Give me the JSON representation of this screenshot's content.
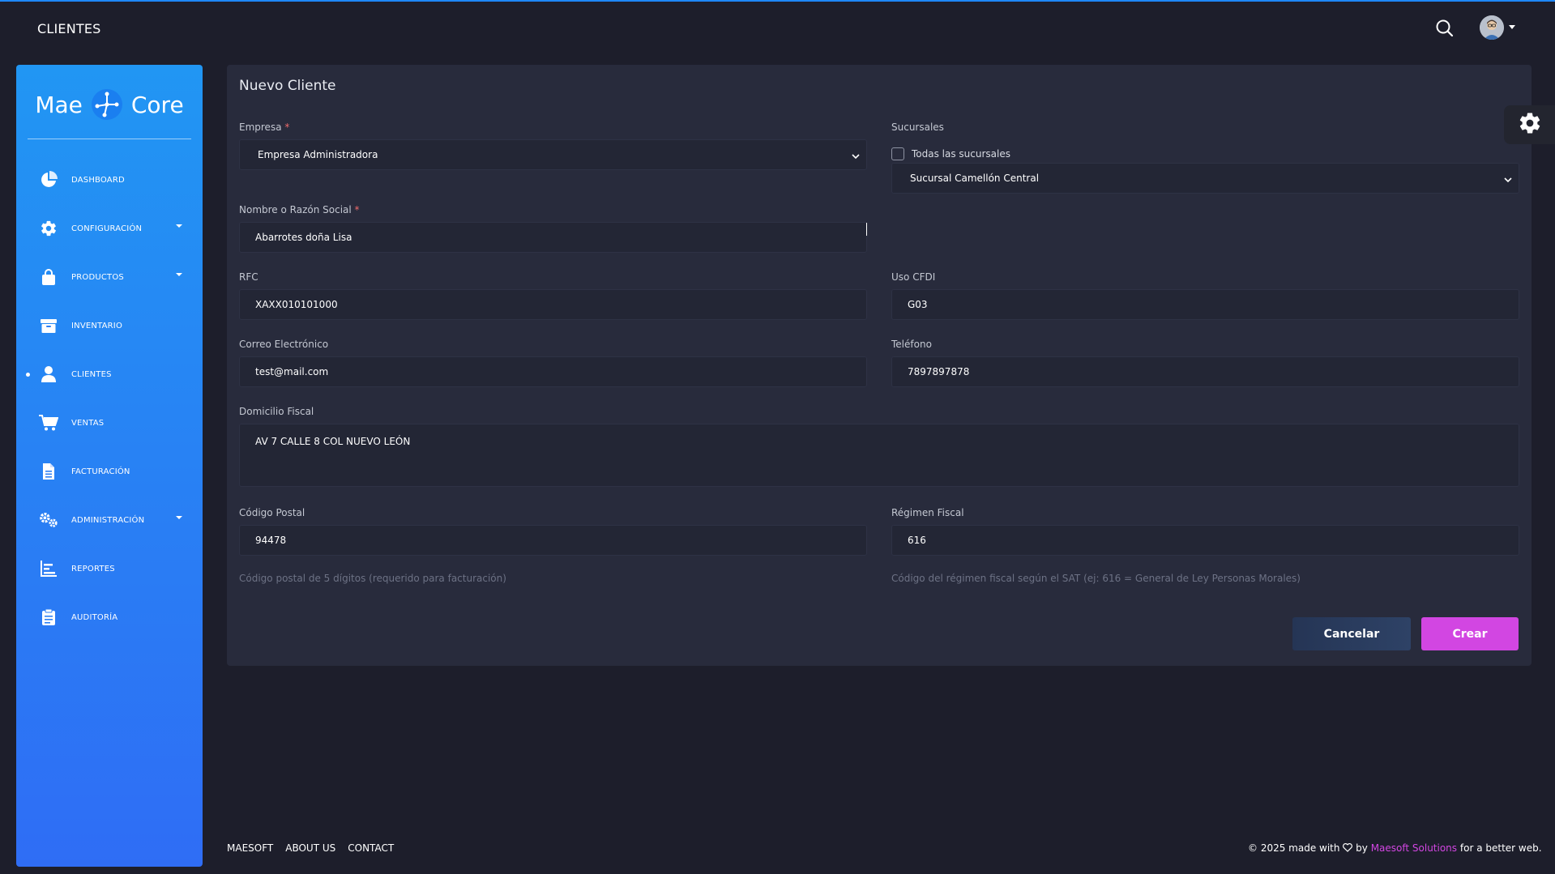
{
  "header": {
    "title": "CLIENTES"
  },
  "brand": {
    "left": "Mae",
    "right": "Core"
  },
  "sidebar": {
    "items": [
      {
        "label": "DASHBOARD",
        "icon": "pie-chart-icon"
      },
      {
        "label": "CONFIGURACIÓN",
        "icon": "gear-icon"
      },
      {
        "label": "PRODUCTOS",
        "icon": "shopping-bag-icon"
      },
      {
        "label": "INVENTARIO",
        "icon": "archive-box-icon"
      },
      {
        "label": "CLIENTES",
        "icon": "user-icon"
      },
      {
        "label": "VENTAS",
        "icon": "cart-icon"
      },
      {
        "label": "FACTURACIÓN",
        "icon": "file-icon"
      },
      {
        "label": "ADMINISTRACIÓN",
        "icon": "gears-icon"
      },
      {
        "label": "REPORTES",
        "icon": "bar-chart-icon"
      },
      {
        "label": "AUDITORÍA",
        "icon": "clipboard-icon"
      }
    ]
  },
  "form": {
    "title": "Nuevo Cliente",
    "empresa": {
      "label": "Empresa",
      "value": "Empresa Administradora"
    },
    "sucursales": {
      "label": "Sucursales",
      "checkbox_label": "Todas las sucursales",
      "value": "Sucursal Camellón Central"
    },
    "nombre": {
      "label": "Nombre o Razón Social",
      "value": "Abarrotes doña Lisa"
    },
    "rfc": {
      "label": "RFC",
      "value": "XAXX010101000"
    },
    "uso_cfdi": {
      "label": "Uso CFDI",
      "value": "G03"
    },
    "correo": {
      "label": "Correo Electrónico",
      "value": "test@mail.com"
    },
    "telefono": {
      "label": "Teléfono",
      "value": "7897897878"
    },
    "domicilio": {
      "label": "Domicilio Fiscal",
      "value": "AV 7 CALLE 8 COL NUEVO LEÓN"
    },
    "codigo_postal": {
      "label": "Código Postal",
      "value": "94478",
      "hint": "Código postal de 5 dígitos (requerido para facturación)"
    },
    "regimen": {
      "label": "Régimen Fiscal",
      "value": "616",
      "hint": "Código del régimen fiscal según el SAT (ej: 616 = General de Ley Personas Morales)"
    },
    "required_mark": "*",
    "cancel_label": "Cancelar",
    "create_label": "Crear"
  },
  "footer": {
    "links": [
      "MAESOFT",
      "ABOUT US",
      "CONTACT"
    ],
    "copyright_prefix": "© 2025 made with",
    "by": "by",
    "brand": "Maesoft Solutions",
    "suffix": "for a better web."
  },
  "colors": {
    "accent": "#d246e2",
    "sidebar_top": "#2196f3",
    "sidebar_bottom": "#2f6df5",
    "background": "#1d1e2b",
    "card": "#282b3c"
  }
}
